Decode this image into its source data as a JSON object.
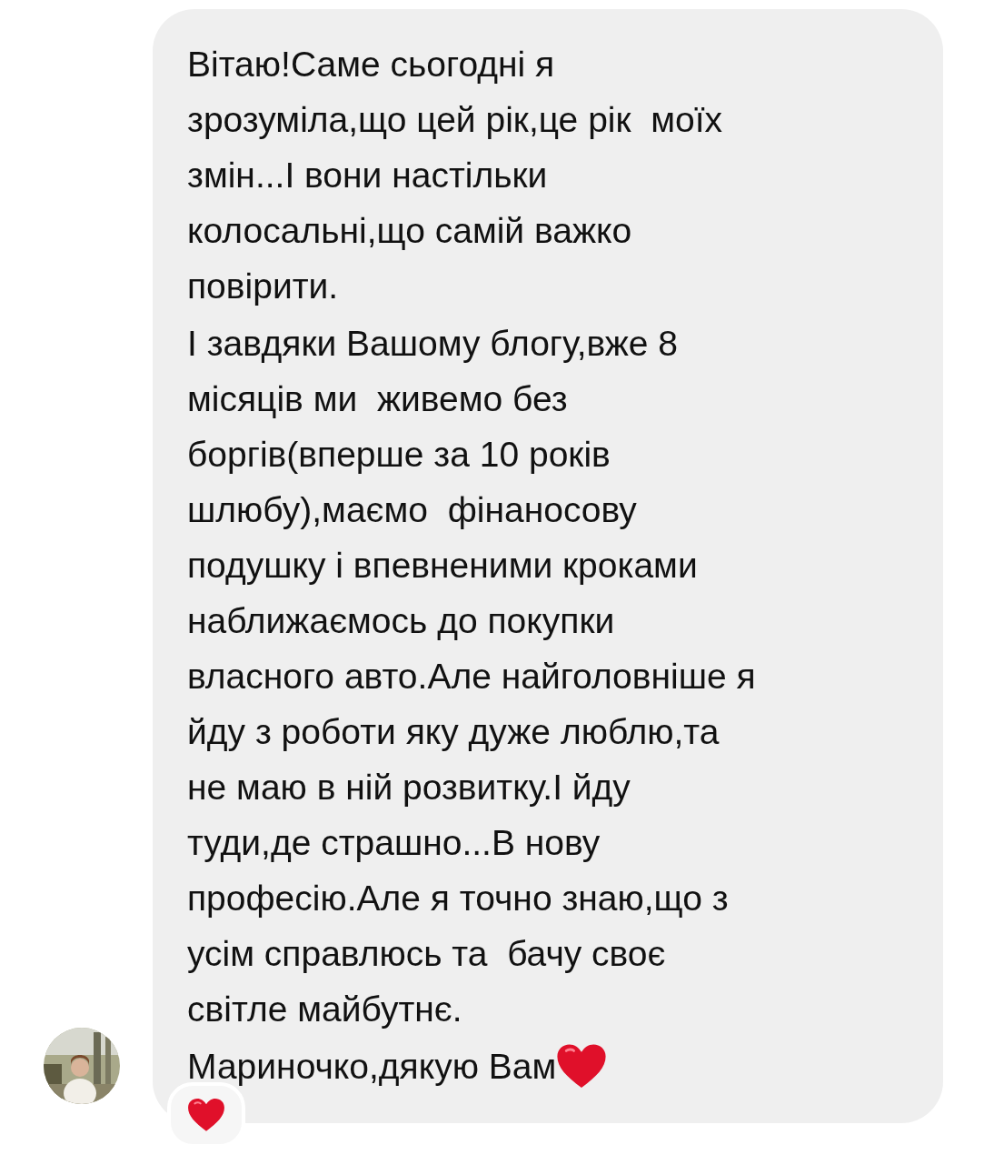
{
  "message": {
    "paragraphs": [
      {
        "lines": [
          "Вітаю!Саме сьогодні я",
          "зрозуміла,що цей рік,це рік  моїх",
          "змін...І вони настільки",
          "колосальні,що самій важко",
          "повірити."
        ]
      },
      {
        "lines": [
          "І завдяки Вашому блогу,вже 8",
          "місяців ми  живемо без",
          "боргів(вперше за 10 років",
          "шлюбу),маємо  фінаносову",
          "подушку і впевненими кроками",
          "наближаємось до покупки",
          "власного авто.Але найголовніше я",
          "йду з роботи яку дуже люблю,та",
          "не маю в ній розвитку.І йду",
          "туди,де страшно...В нову",
          "професію.Але я точно знаю,що з",
          "усім справлюсь та  бачу своє",
          "світле майбутнє."
        ]
      },
      {
        "lines": [
          "Мариночко,дякую Вам"
        ],
        "ending": {
          "kind": "heart"
        }
      }
    ]
  },
  "reactions": [
    {
      "kind": "heart"
    }
  ]
}
